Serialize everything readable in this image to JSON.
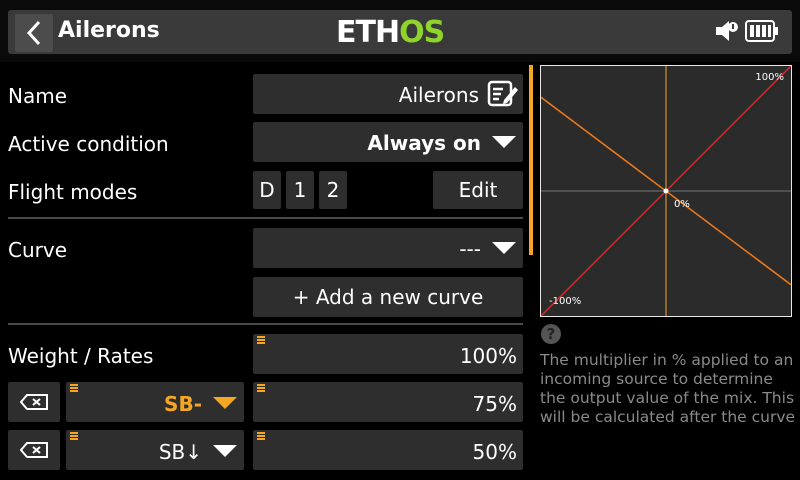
{
  "header": {
    "title": "Ailerons",
    "logo_part1": "ETH",
    "logo_part2": "OS",
    "back_icon": "chevron-left-icon",
    "sound_icon": "speaker-icon",
    "battery_icon": "battery-icon"
  },
  "form": {
    "name_label": "Name",
    "name_value": "Ailerons",
    "active_condition_label": "Active condition",
    "active_condition_value": "Always on",
    "flight_modes_label": "Flight modes",
    "flight_modes": [
      "D",
      "1",
      "2"
    ],
    "edit_button": "Edit",
    "curve_label": "Curve",
    "curve_value": "---",
    "add_curve_button": "+ Add a new curve",
    "weight_label": "Weight / Rates",
    "weight_value": "100%",
    "rates": [
      {
        "source": "SB-",
        "value": "75%",
        "highlight": true
      },
      {
        "source": "SB↓",
        "value": "50%",
        "highlight": false
      }
    ]
  },
  "graph": {
    "top_label": "100%",
    "center_label": "0%",
    "bottom_label": "-100%",
    "lines": [
      {
        "color": "#d92b2b",
        "from": [
          -100,
          -100
        ],
        "to": [
          100,
          100
        ]
      },
      {
        "color": "#f07a1a",
        "from": [
          -100,
          75
        ],
        "to": [
          100,
          -75
        ]
      }
    ]
  },
  "help": {
    "text": "The multiplier in % applied to an incoming source to determine the output value of the mix. This will be calculated after the curve"
  },
  "colors": {
    "accent": "#f5a623",
    "logo_green": "#8ed42b"
  }
}
